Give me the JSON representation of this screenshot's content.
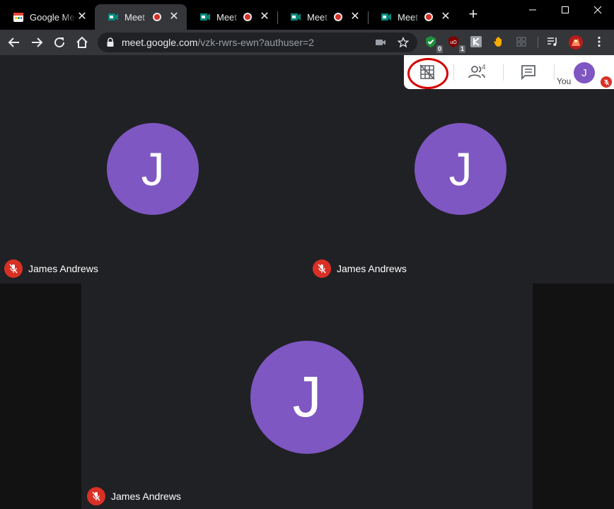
{
  "browser": {
    "tabs": [
      {
        "title": "Google Meet",
        "recording": false,
        "active": false
      },
      {
        "title": "Meet – vzk-rwrs-ewn",
        "recording": true,
        "active": true
      },
      {
        "title": "Meet – vzk-rwrs-ewn",
        "recording": true,
        "active": false
      },
      {
        "title": "Meet – vzk-rwrs-ewn",
        "recording": true,
        "active": false
      },
      {
        "title": "Meet – vzk-rwrs-ewn",
        "recording": true,
        "active": false
      }
    ],
    "new_tab": "+",
    "url_host": "meet.google.com",
    "url_path": "/vzk-rwrs-ewn?authuser=2",
    "extensions": [
      {
        "name": "shield-check-extension",
        "badge": "0",
        "color": "#1e8e3e"
      },
      {
        "name": "ublock-extension",
        "badge": "1",
        "color": "#800000"
      },
      {
        "name": "k-extension",
        "badge": "",
        "color": "#9aa0a6"
      },
      {
        "name": "hand-extension",
        "badge": "",
        "color": "#f9ab00"
      },
      {
        "name": "grid-extension",
        "badge": "",
        "color": "#5f6368"
      }
    ]
  },
  "meet": {
    "participant_count": "4",
    "self_initial": "J",
    "self_label": "You",
    "tiles": [
      {
        "initial": "J",
        "name": "James Andrews",
        "muted": true
      },
      {
        "initial": "J",
        "name": "James Andrews",
        "muted": true
      },
      {
        "initial": "J",
        "name": "James Andrews",
        "muted": true
      }
    ],
    "colors": {
      "avatar": "#7e57c2",
      "mic_off": "#d93025",
      "highlight": "#d50000"
    }
  }
}
